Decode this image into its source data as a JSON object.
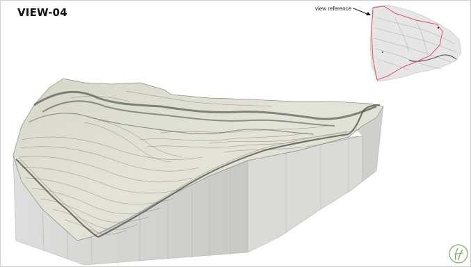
{
  "view": {
    "title": "VIEW-04"
  },
  "reference": {
    "label": "view reference"
  },
  "colors": {
    "terrain_surface": "#dcdcd0",
    "terrain_side": "#d2d2cc",
    "contour": "#555555",
    "reference_outline": "#e05060",
    "logo_green": "#7aa86a"
  },
  "icons": {
    "arrow": "arrow-icon",
    "logo": "logo-icon"
  }
}
